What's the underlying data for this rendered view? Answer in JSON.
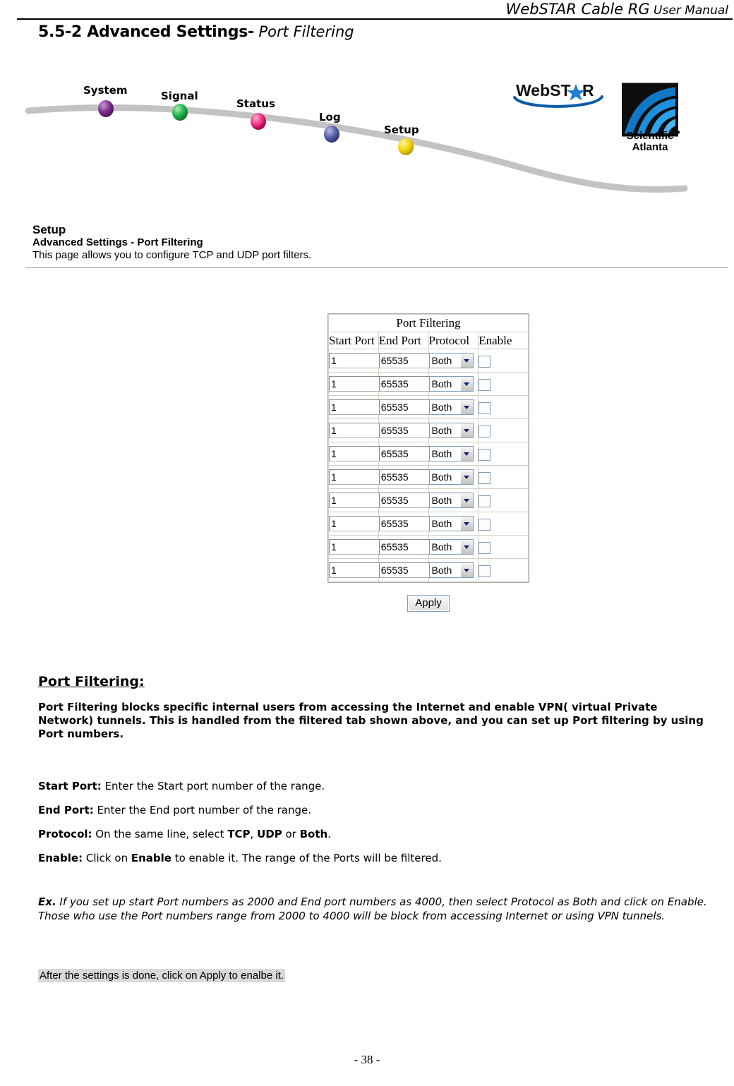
{
  "document": {
    "running_header_main": "WebSTAR Cable RG",
    "running_header_sub": " User Manual",
    "footer_page": "- 38 -"
  },
  "section": {
    "number_title": "5.5-2 Advanced Settings-",
    "subtitle": " Port Filtering"
  },
  "banner": {
    "nav_items": [
      {
        "label": "System",
        "color": "#7b2d8e"
      },
      {
        "label": "Signal",
        "color": "#22b14c"
      },
      {
        "label": "Status",
        "color": "#ec2f7f"
      },
      {
        "label": "Log",
        "color": "#5560a8"
      },
      {
        "label": "Setup",
        "color": "#f5d400"
      }
    ],
    "logo_webstar": "WebST R",
    "logo_sa_line1": "Scientific",
    "logo_sa_line2": "Atlanta"
  },
  "setup": {
    "title": "Setup",
    "subtitle": "Advanced Settings - Port Filtering",
    "description": "This page allows you to configure TCP and UDP port filters."
  },
  "port_filtering": {
    "table_title": "Port Filtering",
    "columns": [
      "Start Port",
      "End Port",
      "Protocol",
      "Enable"
    ],
    "rows": [
      {
        "start": "1",
        "end": "65535",
        "protocol": "Both",
        "enabled": false
      },
      {
        "start": "1",
        "end": "65535",
        "protocol": "Both",
        "enabled": false
      },
      {
        "start": "1",
        "end": "65535",
        "protocol": "Both",
        "enabled": false
      },
      {
        "start": "1",
        "end": "65535",
        "protocol": "Both",
        "enabled": false
      },
      {
        "start": "1",
        "end": "65535",
        "protocol": "Both",
        "enabled": false
      },
      {
        "start": "1",
        "end": "65535",
        "protocol": "Both",
        "enabled": false
      },
      {
        "start": "1",
        "end": "65535",
        "protocol": "Both",
        "enabled": false
      },
      {
        "start": "1",
        "end": "65535",
        "protocol": "Both",
        "enabled": false
      },
      {
        "start": "1",
        "end": "65535",
        "protocol": "Both",
        "enabled": false
      },
      {
        "start": "1",
        "end": "65535",
        "protocol": "Both",
        "enabled": false
      }
    ],
    "protocol_options": [
      "TCP",
      "UDP",
      "Both"
    ],
    "apply_label": "Apply",
    "header_bg": "#99ff99",
    "title_bg": "#c4c4c4"
  },
  "explanation": {
    "heading": "Port Filtering:",
    "intro": "Port Filtering blocks specific internal users from accessing the Internet and enable VPN( virtual Private Network) tunnels. This is handled from the filtered tab shown above, and you can set up Port filtering by using Port numbers.",
    "fields": [
      {
        "label": "Start Port:",
        "text": "  Enter the Start port number of the range."
      },
      {
        "label": "End Port:",
        "text": "  Enter the End port number of the range."
      },
      {
        "label": "Protocol:",
        "text_pre": "  On the same line, select ",
        "b1": "TCP",
        "mid1": ", ",
        "b2": "UDP",
        "mid2": " or ",
        "b3": "Both",
        "text_post": "."
      },
      {
        "label": "Enable:",
        "text_pre": " Click on ",
        "b1": "Enable",
        "text_post": " to enable it. The range of the Ports will be filtered."
      }
    ],
    "example_label": "Ex.",
    "example_text": " If you set up start Port numbers as 2000 and End port numbers as 4000, then select Protocol as Both and click on Enable. Those who use the Port numbers range from 2000 to 4000 will be block from accessing Internet or using VPN tunnels.",
    "note": "After the settings is done, click on Apply to enalbe it."
  }
}
